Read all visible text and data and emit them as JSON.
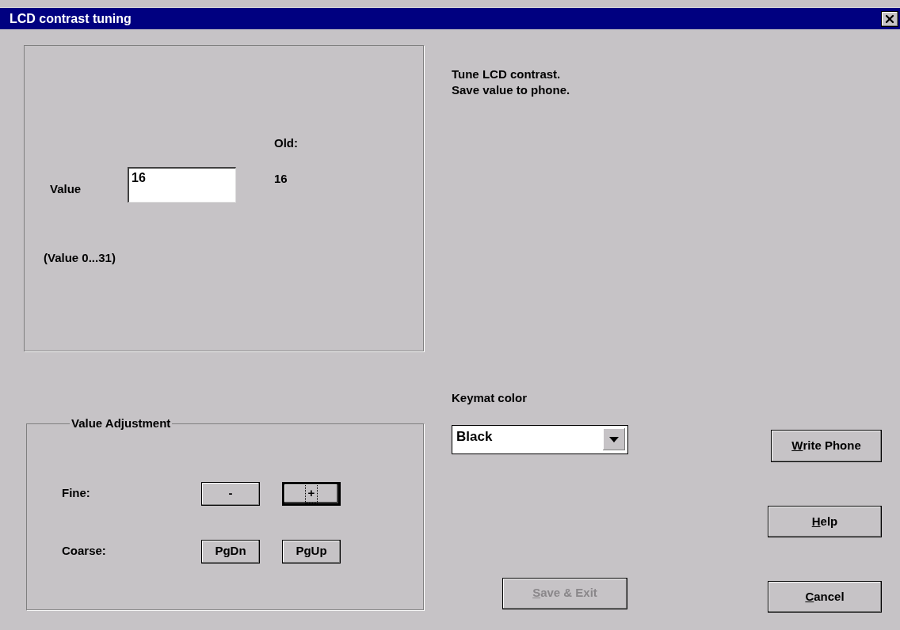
{
  "window": {
    "title": "LCD contrast tuning"
  },
  "value_panel": {
    "old_label": "Old:",
    "old_value": "16",
    "value_label": "Value",
    "value_field": {
      "value": "16"
    },
    "range_note": "(Value 0...31)"
  },
  "value_adjustment": {
    "title": "Value Adjustment",
    "rows": [
      {
        "label": "Fine:",
        "buttons": [
          {
            "label": "-",
            "focused": false
          },
          {
            "label": "+",
            "focused": true
          }
        ]
      },
      {
        "label": "Coarse:",
        "buttons": [
          {
            "label": "PgDn",
            "focused": false
          },
          {
            "label": "PgUp",
            "focused": false
          }
        ]
      }
    ]
  },
  "instructions": [
    "Tune LCD contrast.",
    "Save value to phone."
  ],
  "keymat": {
    "label": "Keymat color",
    "value": "Black"
  },
  "buttons": [
    {
      "kind": "write",
      "mnemonic": "W",
      "rest": "rite Phone",
      "disabled": false
    },
    {
      "kind": "help",
      "mnemonic": "H",
      "rest": "elp",
      "disabled": false
    },
    {
      "kind": "save",
      "mnemonic": "S",
      "rest": "ave & Exit",
      "disabled": true
    },
    {
      "kind": "cancel",
      "mnemonic": "C",
      "rest": "ancel",
      "disabled": false
    }
  ]
}
